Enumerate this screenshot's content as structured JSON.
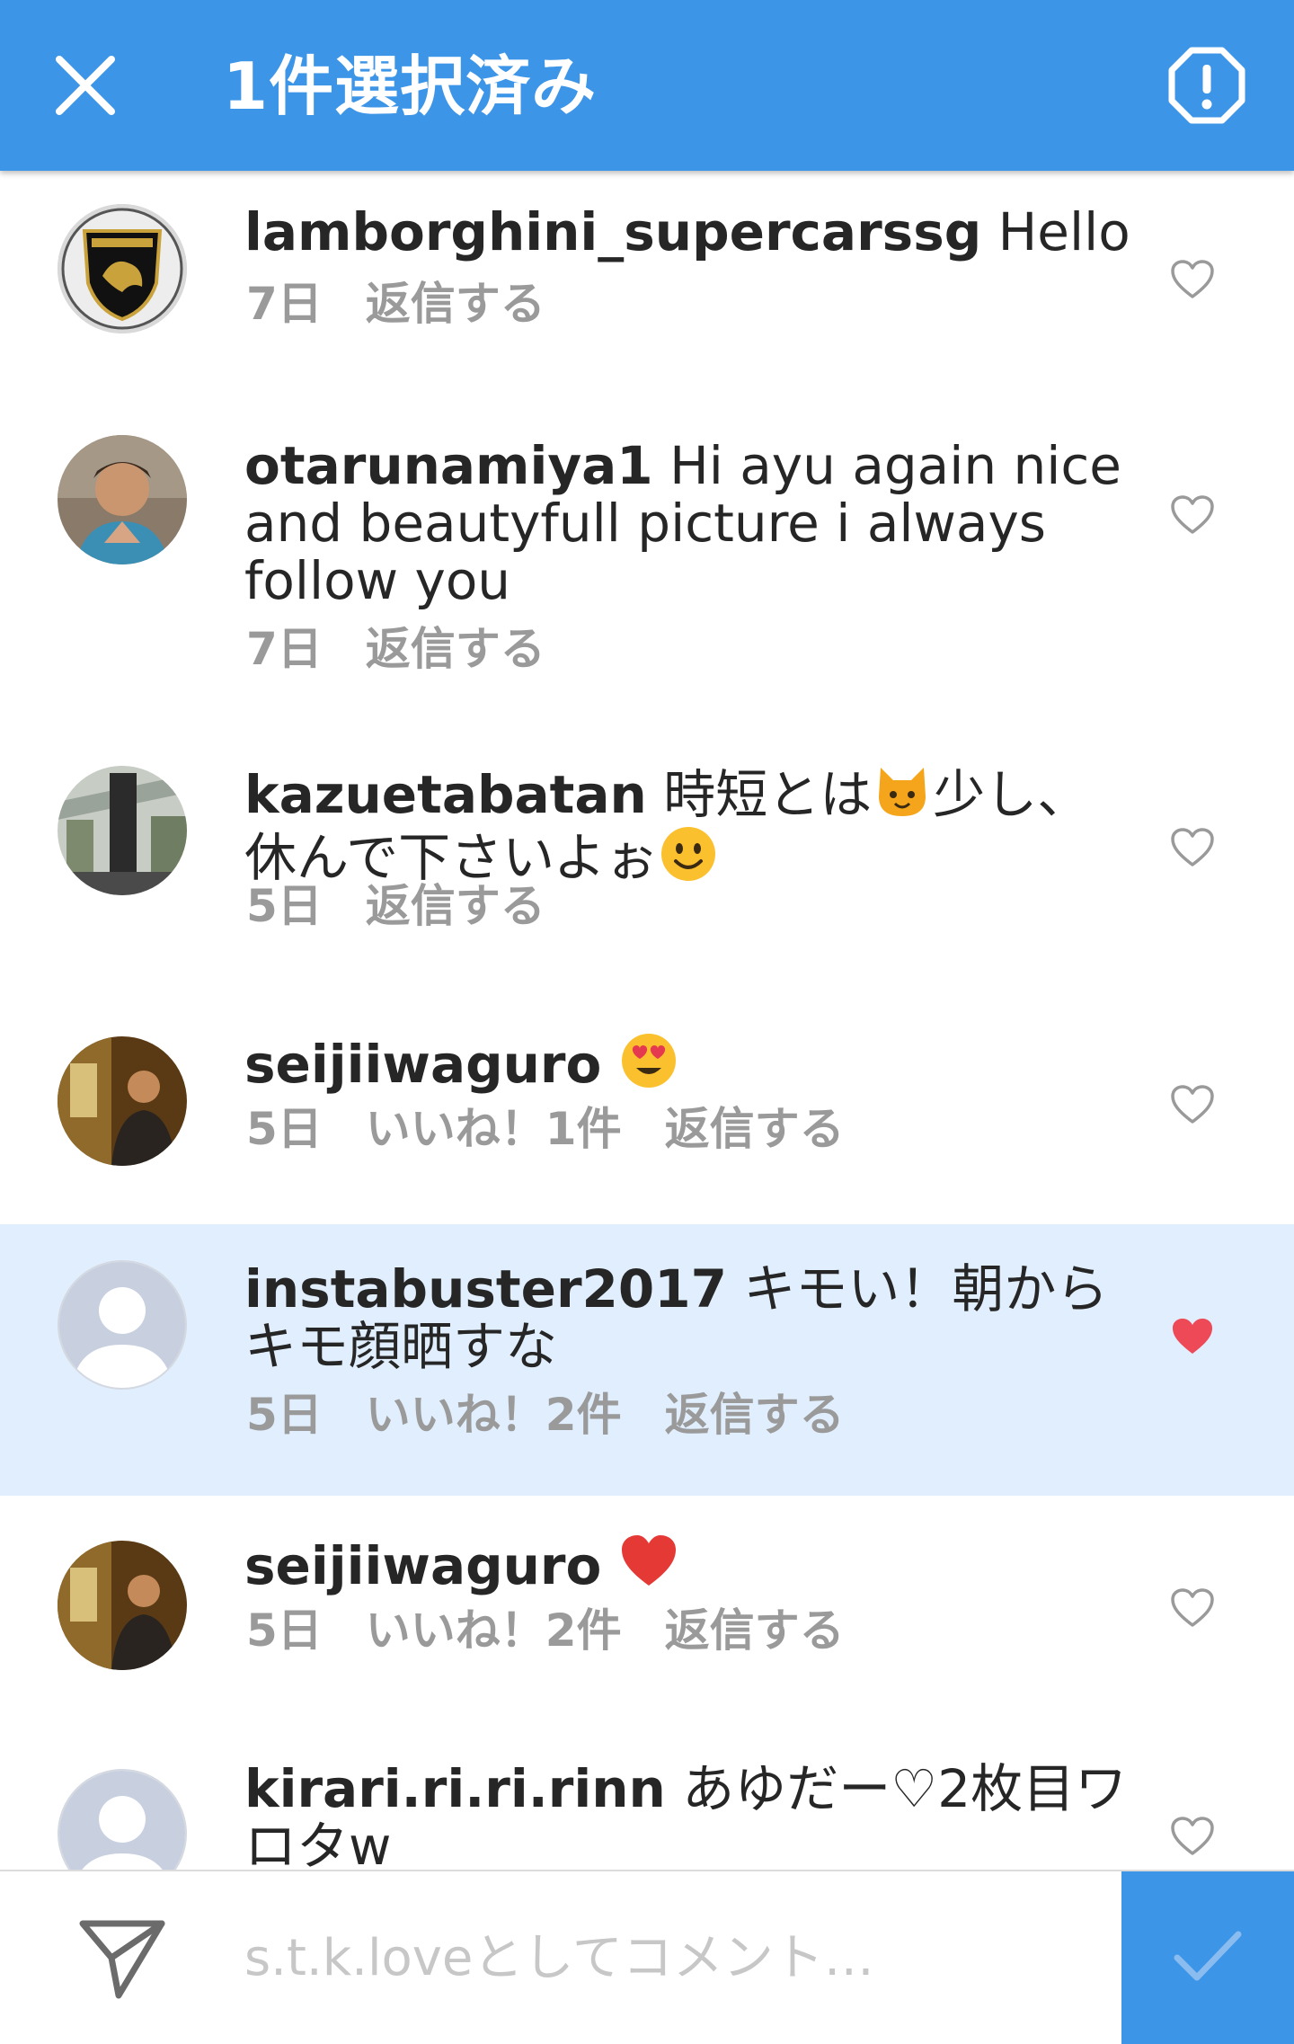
{
  "header": {
    "title": "1件選択済み",
    "close_icon": "close-icon",
    "report_icon": "report-icon",
    "background": "#3d95e8"
  },
  "comments": [
    {
      "username": "lamborghini_supercarssg",
      "text": " Hello",
      "time": "7日",
      "likes": "",
      "reply": "返信する",
      "liked": false,
      "avatar": "lamborghini-logo-avatar"
    },
    {
      "username": "otarunamiya1",
      "text": " Hi ayu again nice and beautyfull picture i always follow you",
      "time": "7日",
      "likes": "",
      "reply": "返信する",
      "liked": false,
      "avatar": "photo-avatar"
    },
    {
      "username": "kazuetabatan",
      "text_before": " 時短とは",
      "emoji1": "cat-face-emoji",
      "text_middle": "少し、休んで下さいよぉ",
      "emoji2": "smiling-face-emoji",
      "time": "5日",
      "likes": "",
      "reply": "返信する",
      "liked": false,
      "avatar": "photo-avatar"
    },
    {
      "username": "seijiiwaguro",
      "emoji": "heart-eyes-emoji",
      "time": "5日",
      "likes": "いいね！1件",
      "reply": "返信する",
      "liked": false,
      "avatar": "photo-avatar"
    },
    {
      "username": "instabuster2017",
      "text": " キモい！朝からキモ顔晒すな",
      "time": "5日",
      "likes": "いいね！2件",
      "reply": "返信する",
      "liked": true,
      "selected": true,
      "avatar": "default-avatar"
    },
    {
      "username": "seijiiwaguro",
      "emoji": "red-heart-emoji",
      "time": "5日",
      "likes": "いいね！2件",
      "reply": "返信する",
      "liked": false,
      "avatar": "photo-avatar"
    },
    {
      "username": "kirari.ri.ri.rinn",
      "text": " あゆだー♡2枚目ワロタw",
      "liked": false,
      "avatar": "default-avatar"
    }
  ],
  "composer": {
    "placeholder": "s.t.k.loveとしてコメント…",
    "send_icon": "send-icon",
    "submit_icon": "checkmark-icon"
  },
  "colors": {
    "accent": "#3d95e8",
    "selected_row": "#e0eefd",
    "liked_heart": "#ed4956",
    "meta_text": "#9a9a9a"
  }
}
